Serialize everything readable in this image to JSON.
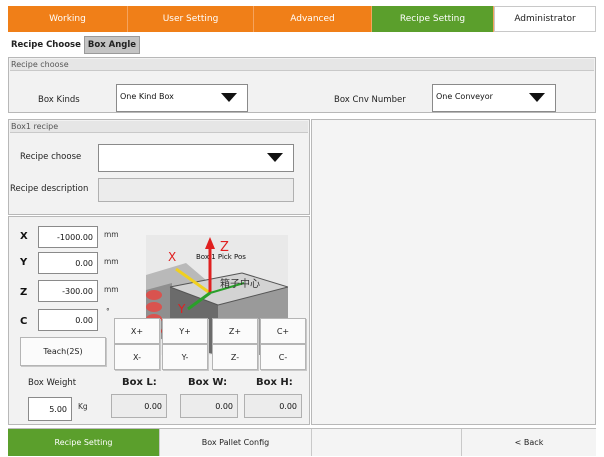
{
  "top_tabs": [
    {
      "label": "Working"
    },
    {
      "label": "User Setting"
    },
    {
      "label": "Advanced"
    },
    {
      "label": "Recipe Setting"
    },
    {
      "label": "Administrator"
    }
  ],
  "sub_tabs": [
    {
      "label": "Recipe Choose"
    },
    {
      "label": "Box Angle"
    }
  ],
  "recipe_choose_panel": {
    "title": "Recipe choose",
    "box_kinds_label": "Box Kinds",
    "box_kinds_value": "One Kind Box",
    "box_cnv_label": "Box Cnv Number",
    "box_cnv_value": "One Conveyor"
  },
  "box1_panel": {
    "title": "Box1 recipe",
    "recipe_choose_label": "Recipe choose",
    "recipe_choose_value": "",
    "recipe_description_label": "Recipe description",
    "recipe_description_value": ""
  },
  "position": {
    "x": {
      "axis": "X",
      "value": "-1000.00",
      "unit": "mm"
    },
    "y": {
      "axis": "Y",
      "value": "0.00",
      "unit": "mm"
    },
    "z": {
      "axis": "Z",
      "value": "-300.00",
      "unit": "mm"
    },
    "c": {
      "axis": "C",
      "value": "0.00",
      "unit": "°"
    },
    "teach_label": "Teach(2S)"
  },
  "pick_image": {
    "label": "Box 1 Pick Pos",
    "center_label": "箱子中心",
    "axis_x": "X",
    "axis_y": "Y",
    "axis_z": "Z",
    "colors": {
      "x_axis": "#f0d020",
      "y_axis": "#2aa02a",
      "z_axis": "#e02020",
      "roller": "#d9534f"
    }
  },
  "jog": {
    "plus": [
      "X+",
      "Y+",
      "Z+",
      "C+"
    ],
    "minus": [
      "X-",
      "Y-",
      "Z-",
      "C-"
    ]
  },
  "weight": {
    "label": "Box Weight",
    "value": "5.00",
    "unit": "Kg"
  },
  "dims": {
    "l_label": "Box L:",
    "w_label": "Box W:",
    "h_label": "Box H:",
    "l_value": "0.00",
    "w_value": "0.00",
    "h_value": "0.00"
  },
  "bottom_bar": {
    "recipe_setting": "Recipe Setting",
    "box_pallet_config": "Box Pallet Config",
    "empty": "",
    "back": "< Back"
  },
  "colors": {
    "orange": "#f07f18",
    "green": "#5b9f2c"
  }
}
